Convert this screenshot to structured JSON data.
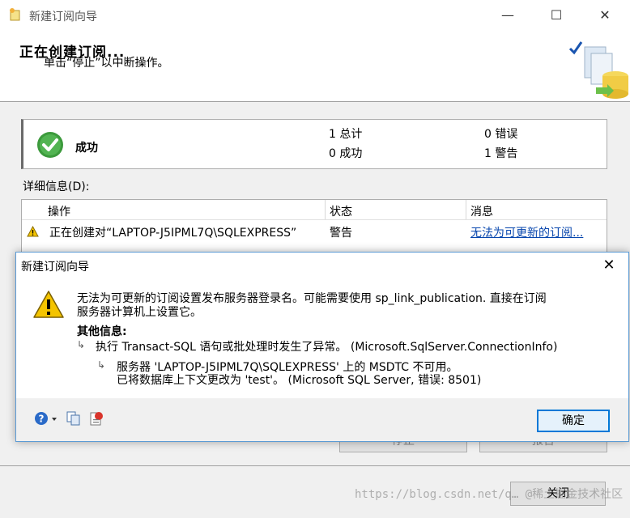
{
  "window": {
    "title": "新建订阅向导",
    "heading": "正在创建订阅...",
    "subheading": "单击“停止”以中断操作。"
  },
  "status": {
    "result": "成功",
    "total_label": "1 总计",
    "success_label": "0 成功",
    "error_label": "0 错误",
    "warning_label": "1 警告"
  },
  "details": {
    "label": "详细信息(D):",
    "columns": [
      "操作",
      "状态",
      "消息"
    ],
    "rows": [
      {
        "action": "正在创建对“LAPTOP-J5IPML7Q\\SQLEXPRESS”",
        "state": "警告",
        "message": "无法为可更新的订阅..."
      }
    ]
  },
  "background_buttons": {
    "stop": "停止",
    "report": "报告",
    "close": "关闭"
  },
  "dialog": {
    "title": "新建订阅向导",
    "message_line1": "无法为可更新的订阅设置发布服务器登录名。可能需要使用 sp_link_publication. 直接在订阅",
    "message_line2": "服务器计算机上设置它。",
    "other_info_label": "其他信息:",
    "detail1": "执行 Transact-SQL 语句或批处理时发生了异常。 (Microsoft.SqlServer.ConnectionInfo)",
    "detail2_line1": "服务器 'LAPTOP-J5IPML7Q\\SQLEXPRESS' 上的 MSDTC 不可用。",
    "detail2_line2": "已将数据库上下文更改为 'test'。 (Microsoft SQL Server, 错误: 8501)",
    "ok_label": "确定"
  },
  "watermark": "https://blog.csdn.net/q…  @稀土掘金技术社区",
  "icons": {
    "success": "check-circle-icon",
    "warning": "warning-triangle-icon",
    "help": "help-icon",
    "copy": "copy-icon",
    "details": "details-icon"
  },
  "colors": {
    "accent": "#0078d7",
    "success": "#3c9a3c",
    "warning": "#f4c400",
    "link": "#0645ad"
  }
}
